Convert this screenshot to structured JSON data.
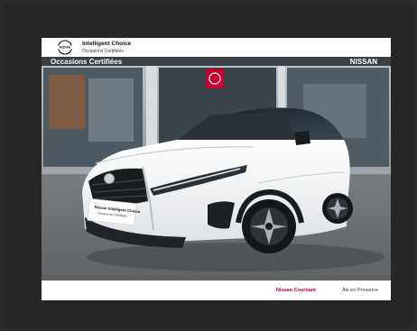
{
  "header": {
    "logo_text": "NISSAN",
    "title": "Intelligent Choice",
    "subtitle": "Occasions Certifiées"
  },
  "photo": {
    "storefront_left_text": "Occasions Certifiées",
    "storefront_right_text": "NISSAN",
    "plate_title": "Nissan Intelligent Choice",
    "plate_subtitle": "Occasions Certifiées"
  },
  "footer": {
    "dealer": "Nissan Courtiant",
    "city": "Aix en Provence"
  },
  "colors": {
    "nissan_red": "#c3002f",
    "car_white": "#f4f5f6",
    "frame": "#262626"
  }
}
